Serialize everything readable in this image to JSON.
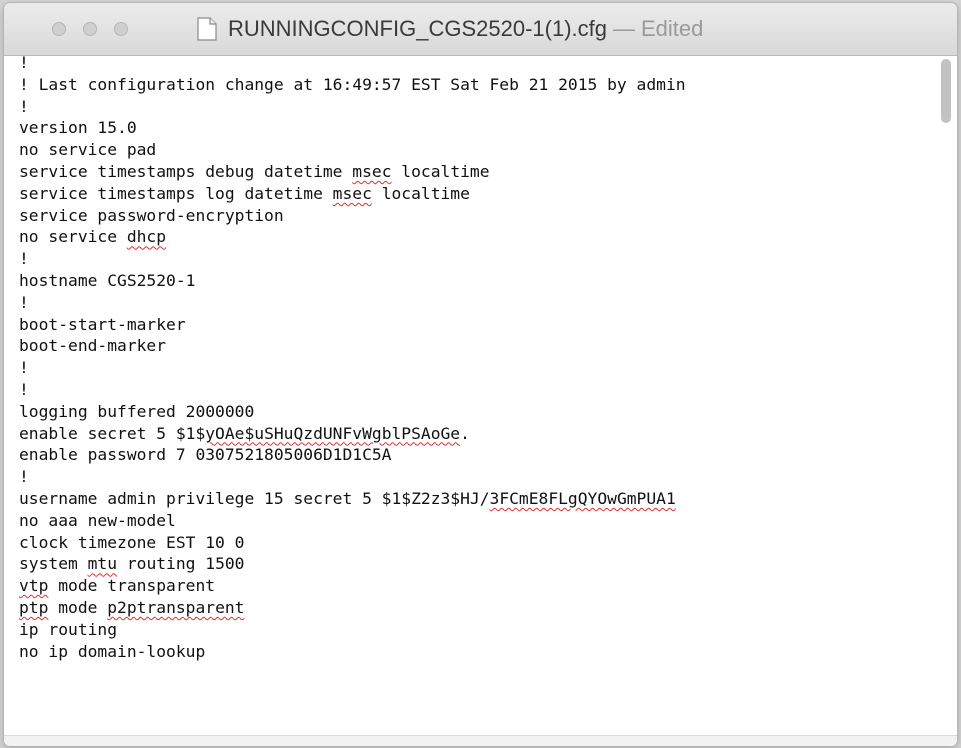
{
  "window": {
    "filename": "RUNNINGCONFIG_CGS2520-1(1).cfg",
    "separator": "—",
    "status": "Edited"
  },
  "document": {
    "lines": [
      "!",
      "! Last configuration change at 16:49:57 EST Sat Feb 21 2015 by admin",
      "!",
      "version 15.0",
      "no service pad",
      "service timestamps debug datetime msec localtime",
      "service timestamps log datetime msec localtime",
      "service password-encryption",
      "no service dhcp",
      "!",
      "hostname CGS2520-1",
      "!",
      "boot-start-marker",
      "boot-end-marker",
      "!",
      "!",
      "logging buffered 2000000",
      "enable secret 5 $1$yOAe$uSHuQzdUNFvWgblPSAoGe.",
      "enable password 7 0307521805006D1D1C5A",
      "!",
      "username admin privilege 15 secret 5 $1$Z2z3$HJ/3FCmE8FLgQYOwGmPUA1",
      "no aaa new-model",
      "clock timezone EST 10 0",
      "system mtu routing 1500",
      "vtp mode transparent",
      "ptp mode p2ptransparent",
      "ip routing",
      "no ip domain-lookup"
    ],
    "spellcheck_words": [
      "msec",
      "dhcp",
      "yOAe$uSHuQzdUNFvWgblPSAoGe",
      "3FCmE8FLgQYOwGmPUA1",
      "mtu",
      "vtp",
      "ptp",
      "p2ptransparent"
    ]
  },
  "icons": {
    "close": "close-button-icon",
    "minimize": "minimize-button-icon",
    "zoom": "zoom-button-icon",
    "document": "document-icon"
  },
  "colors": {
    "spell_underline": "#e03030",
    "traffic_inactive": "#cfcfcf",
    "title_status": "#9a9a9a"
  }
}
